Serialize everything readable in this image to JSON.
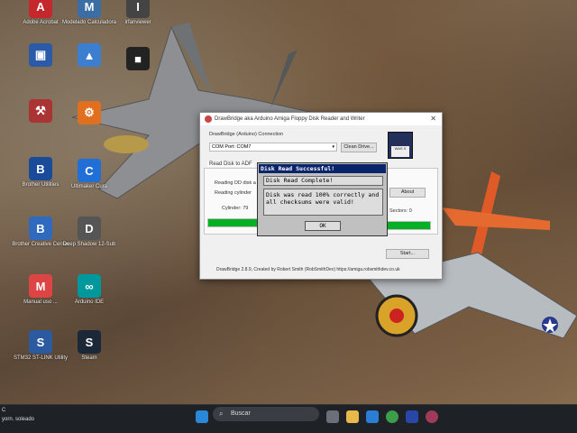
{
  "desktop": {
    "icons": [
      {
        "label": "Adobe Acrobat",
        "color": "#c4272c",
        "glyph": "A"
      },
      {
        "label": "Modelado Calculadora",
        "color": "#3a6ea5",
        "glyph": "M"
      },
      {
        "label": "Irfanviewer",
        "color": "#444",
        "glyph": "I"
      },
      {
        "label": "Ultimaker Cura",
        "color": "#1f6fd6",
        "glyph": "C"
      },
      {
        "label": "Brother Utilities",
        "color": "#1a4a9a",
        "glyph": "B"
      },
      {
        "label": "Brother Creative Center",
        "color": "#2f6abf",
        "glyph": "B"
      },
      {
        "label": "Deep Shadow 12-Sub",
        "color": "#555",
        "glyph": "D"
      },
      {
        "label": "Manual uso ...",
        "color": "#d44",
        "glyph": "M"
      },
      {
        "label": "Arduino IDE",
        "color": "#00979d",
        "glyph": "∞"
      },
      {
        "label": "STM32 ST-LINK Utility",
        "color": "#2c5aa0",
        "glyph": "S"
      },
      {
        "label": "Steam",
        "color": "#1b2838",
        "glyph": "S"
      }
    ],
    "weather": "yorn. soleado"
  },
  "main_window": {
    "title": "DrawBridge aka Arduino Amiga Floppy Disk Reader and Writer",
    "connection_label": "DrawBridge (Arduino) Connection",
    "com_port_label": "COM Port:",
    "com_port_value": "COM7",
    "clean_drive_button": "Clean Drive...",
    "disk_label": "WAS S",
    "tab_label": "Read Disk to ADF",
    "reading_dd_label": "Reading DD disk a",
    "reading_cylinder_label": "Reading cylinder",
    "cylinder_label": "Cylinder: 79",
    "sectors_label": "Sectors:  0",
    "about_button": "About",
    "start_button": "Start...",
    "progress_left": 1.0,
    "progress_right": 1.0,
    "footer": "DrawBridge 2.8.9, Created by Robert Smith (RobSmithDev) https://amiga.robsmithdev.co.uk"
  },
  "popup": {
    "title": "Disk Read Successful!",
    "heading": "Disk Read Complete!",
    "body_line1": "Disk was read 100% correctly and",
    "body_line2": "all checksums were valid!",
    "ok_button": "OK"
  },
  "taskbar": {
    "search_placeholder": "Buscar",
    "time": "C"
  }
}
